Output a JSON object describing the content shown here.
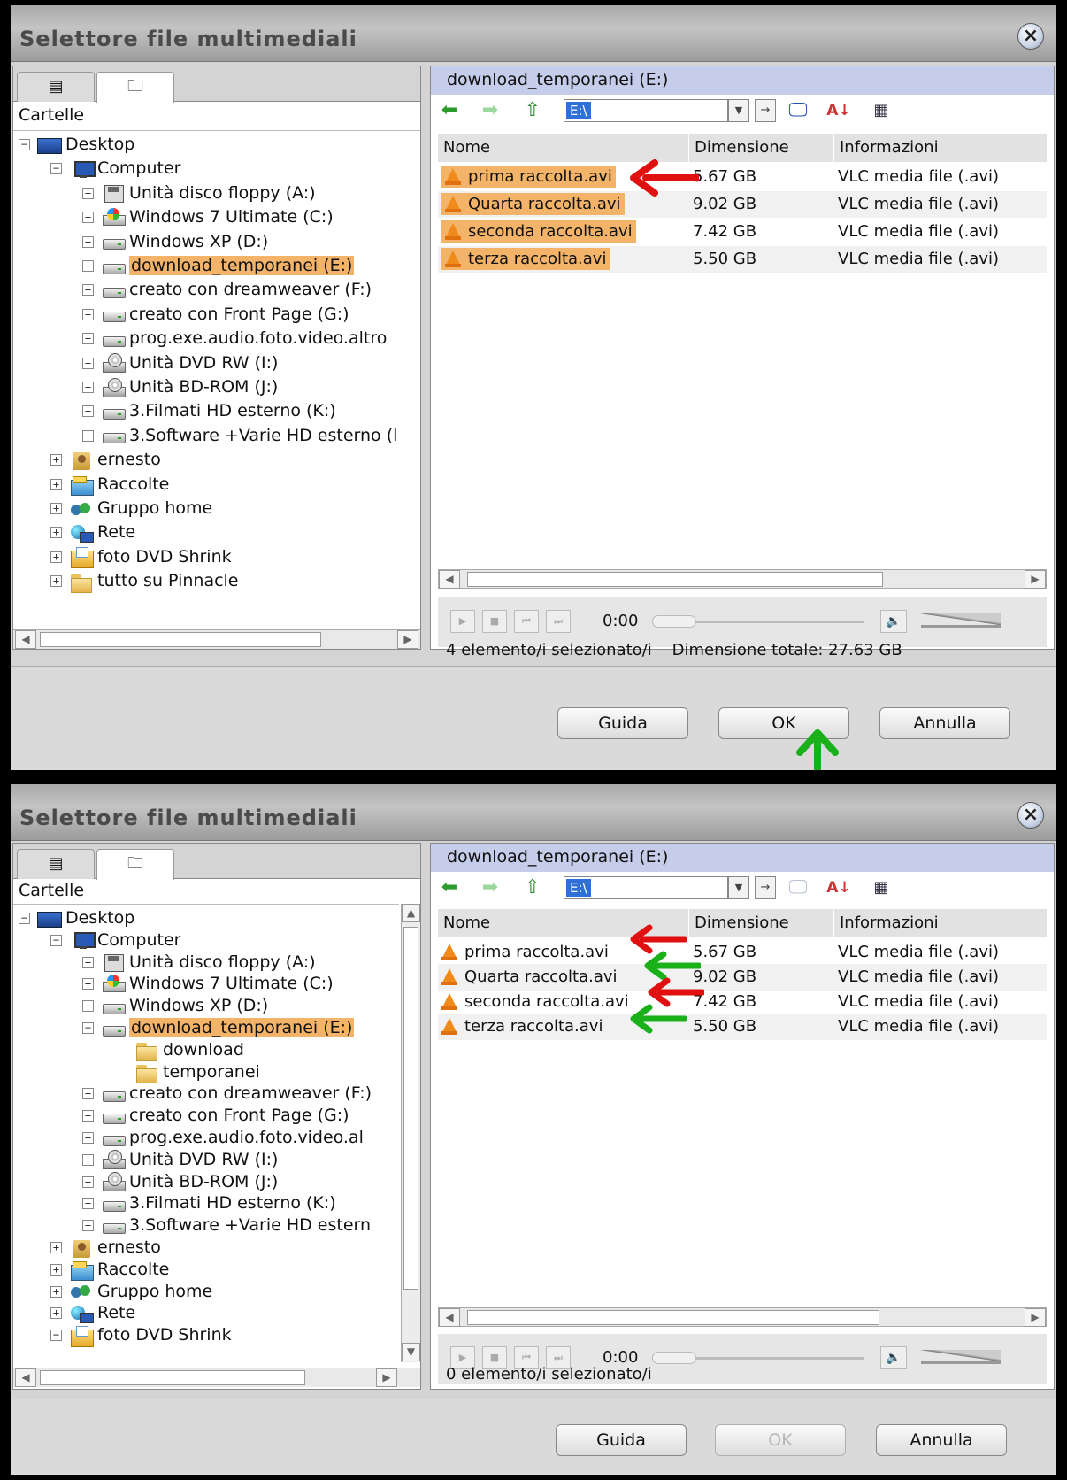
{
  "dialog_title": "Selettore file multimediali",
  "close_glyph": "×",
  "left_panel": {
    "label": "Cartelle"
  },
  "right_panel": {
    "header": "download_temporanei (E:)",
    "path_value": "E:\\",
    "columns": [
      "Nome",
      "Dimensione",
      "Informazioni"
    ]
  },
  "files": [
    {
      "name": "prima raccolta.avi",
      "size": "5.67 GB",
      "info": "VLC media file (.avi)"
    },
    {
      "name": "Quarta raccolta.avi",
      "size": "9.02 GB",
      "info": "VLC media file (.avi)"
    },
    {
      "name": "seconda raccolta.avi",
      "size": "7.42 GB",
      "info": "VLC media file (.avi)"
    },
    {
      "name": "terza raccolta.avi",
      "size": "5.50 GB",
      "info": "VLC media file (.avi)"
    }
  ],
  "player": {
    "time": "0:00"
  },
  "buttons": {
    "help": "Guida",
    "ok": "OK",
    "cancel": "Annulla"
  },
  "dialog1": {
    "tree": [
      {
        "label": "Desktop",
        "icon": "desktop-icon",
        "expander": "−"
      },
      {
        "label": "Computer",
        "icon": "computer-icon",
        "expander": "−"
      },
      {
        "label": "Unità disco floppy (A:)",
        "icon": "floppy-drive-icon",
        "expander": "+"
      },
      {
        "label": "Windows 7 Ultimate (C:)",
        "icon": "windows-drive-icon",
        "expander": "+"
      },
      {
        "label": "Windows XP (D:)",
        "icon": "hard-drive-icon",
        "expander": "+"
      },
      {
        "label": "download_temporanei (E:)",
        "icon": "hard-drive-icon",
        "expander": "+",
        "selected": true
      },
      {
        "label": "creato con dreamweaver (F:)",
        "icon": "hard-drive-icon",
        "expander": "+"
      },
      {
        "label": "creato con  Front Page (G:)",
        "icon": "hard-drive-icon",
        "expander": "+"
      },
      {
        "label": "prog.exe.audio.foto.video.altro",
        "icon": "hard-drive-icon",
        "expander": "+"
      },
      {
        "label": "Unità DVD RW (I:)",
        "icon": "dvd-drive-icon",
        "expander": "+"
      },
      {
        "label": "Unità BD-ROM (J:)",
        "icon": "dvd-drive-icon",
        "expander": "+"
      },
      {
        "label": "3.Filmati HD esterno (K:)",
        "icon": "hard-drive-icon",
        "expander": "+"
      },
      {
        "label": "3.Software +Varie HD esterno (l",
        "icon": "hard-drive-icon",
        "expander": "+"
      },
      {
        "label": "ernesto",
        "icon": "user-folder-icon",
        "expander": "+"
      },
      {
        "label": "Raccolte",
        "icon": "libraries-icon",
        "expander": "+"
      },
      {
        "label": "Gruppo home",
        "icon": "homegroup-icon",
        "expander": "+"
      },
      {
        "label": "Rete",
        "icon": "network-icon",
        "expander": "+"
      },
      {
        "label": "foto DVD Shrink",
        "icon": "photo-folder-icon",
        "expander": "+"
      },
      {
        "label": "tutto su Pinnacle",
        "icon": "folder-icon",
        "expander": "+"
      }
    ],
    "status": "4 elemento/i selezionato/i",
    "total": "Dimensione totale: 27.63 GB",
    "ok_enabled": true
  },
  "dialog2": {
    "tree": [
      {
        "label": "Desktop",
        "icon": "desktop-icon",
        "expander": "−"
      },
      {
        "label": "Computer",
        "icon": "computer-icon",
        "expander": "−"
      },
      {
        "label": "Unità disco floppy (A:)",
        "icon": "floppy-drive-icon",
        "expander": "+"
      },
      {
        "label": "Windows 7 Ultimate (C:)",
        "icon": "windows-drive-icon",
        "expander": "+"
      },
      {
        "label": "Windows XP (D:)",
        "icon": "hard-drive-icon",
        "expander": "+"
      },
      {
        "label": "download_temporanei (E:)",
        "icon": "hard-drive-icon",
        "expander": "−",
        "selected": true
      },
      {
        "label": "download",
        "icon": "folder-icon",
        "expander": ""
      },
      {
        "label": "temporanei",
        "icon": "folder-icon",
        "expander": ""
      },
      {
        "label": "creato con dreamweaver (F:)",
        "icon": "hard-drive-icon",
        "expander": "+"
      },
      {
        "label": "creato con  Front Page (G:)",
        "icon": "hard-drive-icon",
        "expander": "+"
      },
      {
        "label": "prog.exe.audio.foto.video.al",
        "icon": "hard-drive-icon",
        "expander": "+"
      },
      {
        "label": "Unità DVD RW (I:)",
        "icon": "dvd-drive-icon",
        "expander": "+"
      },
      {
        "label": "Unità BD-ROM (J:)",
        "icon": "dvd-drive-icon",
        "expander": "+"
      },
      {
        "label": "3.Filmati HD esterno (K:)",
        "icon": "hard-drive-icon",
        "expander": "+"
      },
      {
        "label": "3.Software +Varie HD estern",
        "icon": "hard-drive-icon",
        "expander": "+"
      },
      {
        "label": "ernesto",
        "icon": "user-folder-icon",
        "expander": "+"
      },
      {
        "label": "Raccolte",
        "icon": "libraries-icon",
        "expander": "+"
      },
      {
        "label": "Gruppo home",
        "icon": "homegroup-icon",
        "expander": "+"
      },
      {
        "label": "Rete",
        "icon": "network-icon",
        "expander": "+"
      },
      {
        "label": "foto DVD Shrink",
        "icon": "photo-folder-icon",
        "expander": "−"
      }
    ],
    "status": "0 elemento/i selezionato/i",
    "ok_enabled": false
  },
  "annotations": {
    "arrow_colors": {
      "red": "#e01010",
      "green": "#19b019"
    }
  }
}
